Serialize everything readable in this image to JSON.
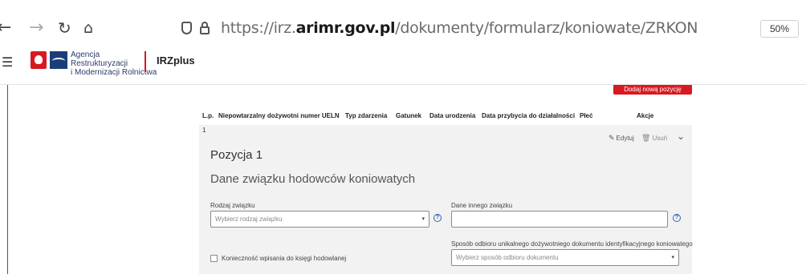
{
  "browser": {
    "url_prefix": "https://irz.",
    "url_domain": "arimr.gov.pl",
    "url_path": "/dokumenty/formularz/koniowate/ZRKON",
    "zoom": "50%"
  },
  "header": {
    "agency_line1": "Agencja Restrukturyzacji",
    "agency_line2": "i Modernizacji Rolnictwa",
    "app_name": "IRZplus"
  },
  "toolbar": {
    "add_position_label": "Dodaj nową pozycję"
  },
  "table": {
    "headers": [
      "L.p.",
      "Niepowtarzalny dożywotni numer UELN",
      "Typ zdarzenia",
      "Gatunek",
      "Data urodzenia",
      "Data przybycia do działalności",
      "Płeć",
      "Akcje"
    ],
    "rows": [
      {
        "index": "1",
        "edit_label": "Edytuj",
        "delete_label": "Usuń"
      }
    ]
  },
  "form": {
    "position_title": "Pozycja 1",
    "section_title": "Dane związku hodowców koniowatych",
    "union_type_label": "Rodzaj związku",
    "union_type_placeholder": "Wybierz rodzaj związku",
    "other_union_label": "Dane innego związku",
    "other_union_value": "",
    "receipt_method_label": "Sposób odbioru unikalnego dożywotniego dokumentu identyfikacyjnego koniowatego",
    "receipt_method_placeholder": "Wybierz sposób odbioru dokumentu",
    "stud_book_label": "Konieczność wpisania do księgi hodowlanej"
  },
  "colors": {
    "accent_red": "#d71920",
    "brand_blue": "#1b3e7a",
    "help_blue": "#2a66b8"
  }
}
